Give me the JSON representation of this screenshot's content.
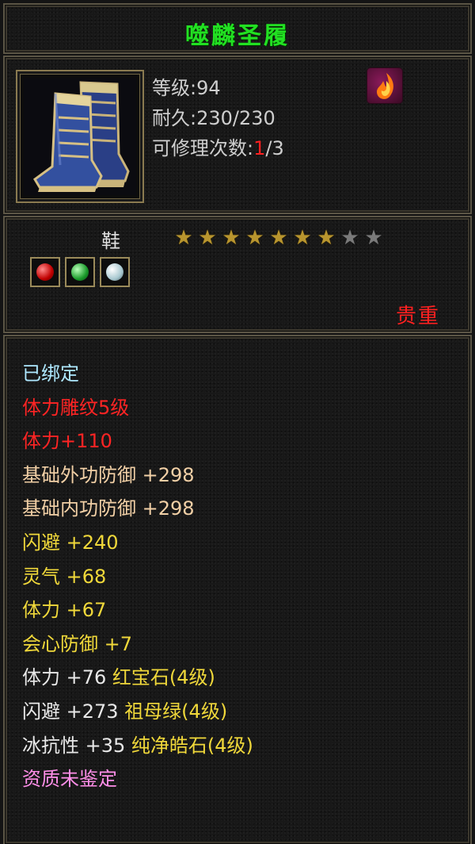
{
  "item": {
    "name": "噬麟圣履",
    "level_label": "等级:",
    "level_value": "94",
    "durability_label": "耐久:",
    "durability_value": "230/230",
    "repair_label": "可修理次数:",
    "repair_used": "1",
    "repair_total": "/3",
    "type": "鞋",
    "stars_filled": 7,
    "stars_total": 9,
    "quality": "贵重",
    "gems": [
      "ruby-red",
      "emerald-green",
      "diamond-white"
    ],
    "icon": "blue-boots-icon",
    "badge_icon": "flame-badge-icon"
  },
  "colors": {
    "name": "#22e022",
    "quality": "#ff2020",
    "star_gold": "#b8952e",
    "star_grey": "#7a7a7a"
  },
  "attributes": [
    {
      "text": "已绑定",
      "color": "cyan"
    },
    {
      "text": "体力雕纹5级",
      "color": "red"
    },
    {
      "text": "体力+110",
      "color": "red"
    },
    {
      "text": "基础外功防御  +298",
      "color": "peach"
    },
    {
      "text": "基础内功防御  +298",
      "color": "peach"
    },
    {
      "text": "闪避  +240",
      "color": "yellow"
    },
    {
      "text": "灵气  +68",
      "color": "yellow"
    },
    {
      "text": "体力  +67",
      "color": "yellow"
    },
    {
      "text": "会心防御  +7",
      "color": "yellow"
    },
    {
      "parts": [
        {
          "text": "体力  +76  ",
          "color": "white"
        },
        {
          "text": "红宝石(4级)",
          "color": "yellow"
        }
      ]
    },
    {
      "parts": [
        {
          "text": "闪避  +273  ",
          "color": "white"
        },
        {
          "text": "祖母绿(4级)",
          "color": "yellow"
        }
      ]
    },
    {
      "parts": [
        {
          "text": "冰抗性  +35  ",
          "color": "white"
        },
        {
          "text": "纯净皓石(4级)",
          "color": "yellow"
        }
      ]
    },
    {
      "text": "资质未鉴定",
      "color": "pink"
    }
  ]
}
